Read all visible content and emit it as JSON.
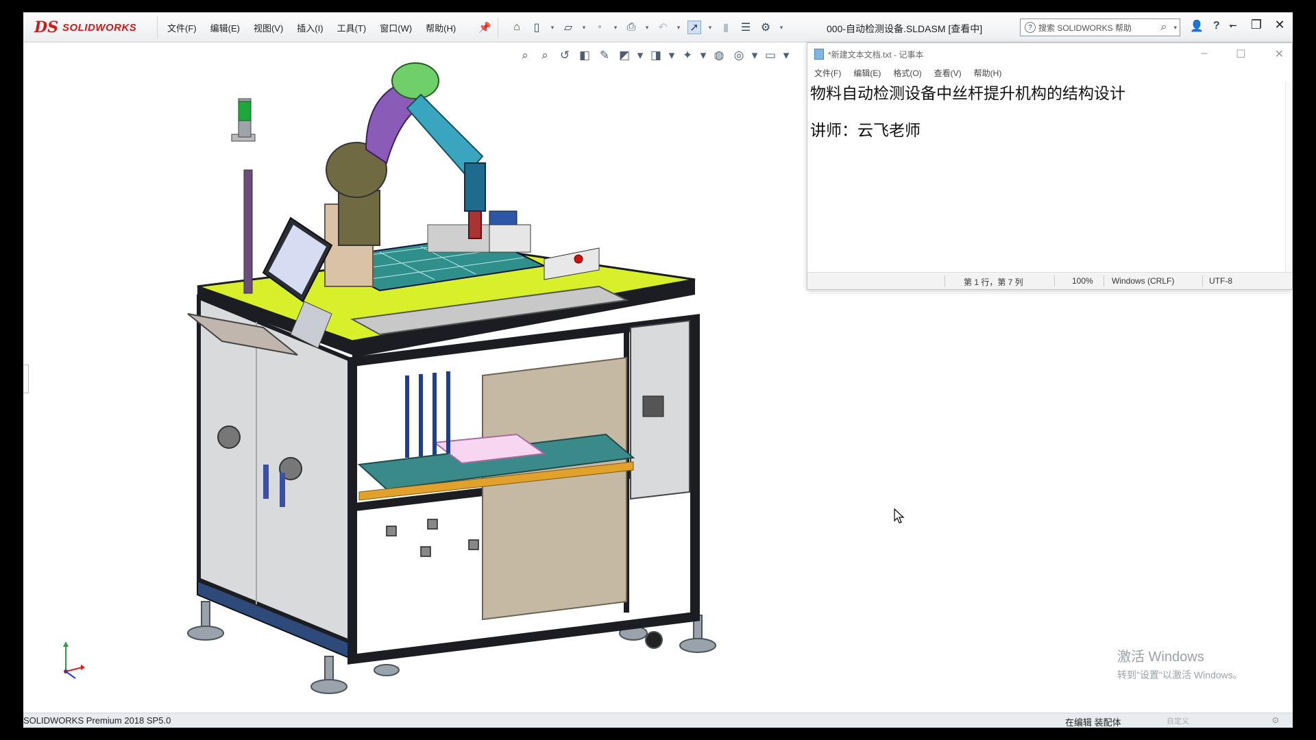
{
  "app": {
    "brand_mark": "DS",
    "brand_name": "SOLIDWORKS",
    "menu": [
      "文件(F)",
      "编辑(E)",
      "视图(V)",
      "插入(I)",
      "工具(T)",
      "窗口(W)",
      "帮助(H)"
    ],
    "document_title": "000-自动检测设备.SLDASM [查看中]",
    "search_placeholder": "搜索 SOLIDWORKS 帮助",
    "help_glyph": "?",
    "status_version": "SOLIDWORKS Premium 2018 SP5.0",
    "status_mode": "在编辑 装配体",
    "status_custom": "自定义"
  },
  "notepad": {
    "title": "*新建文本文档.txt - 记事本",
    "menu": [
      "文件(F)",
      "编辑(E)",
      "格式(O)",
      "查看(V)",
      "帮助(H)"
    ],
    "lines": [
      "物料自动检测设备中丝杆提升机构的结构设计",
      "",
      "讲师：云飞老师"
    ],
    "status": {
      "position": "第 1 行，第 7 列",
      "zoom": "100%",
      "line_ending": "Windows (CRLF)",
      "encoding": "UTF-8"
    }
  },
  "watermark": {
    "title": "激活 Windows",
    "subtitle": "转到\"设置\"以激活 Windows。"
  },
  "colors": {
    "brand_red": "#d11a1a",
    "table_top": "#d8f02a",
    "frame_black": "#1b1d22",
    "panel_gray": "#d9dadc",
    "robot_green": "#6fd06a",
    "robot_purple": "#8a5cb8",
    "robot_teal": "#3aa5bf",
    "robot_olive": "#6f6a42"
  },
  "icons": {
    "pin": "pin-icon",
    "triad": "triad-icon",
    "cursor": "mouse-cursor-icon"
  }
}
